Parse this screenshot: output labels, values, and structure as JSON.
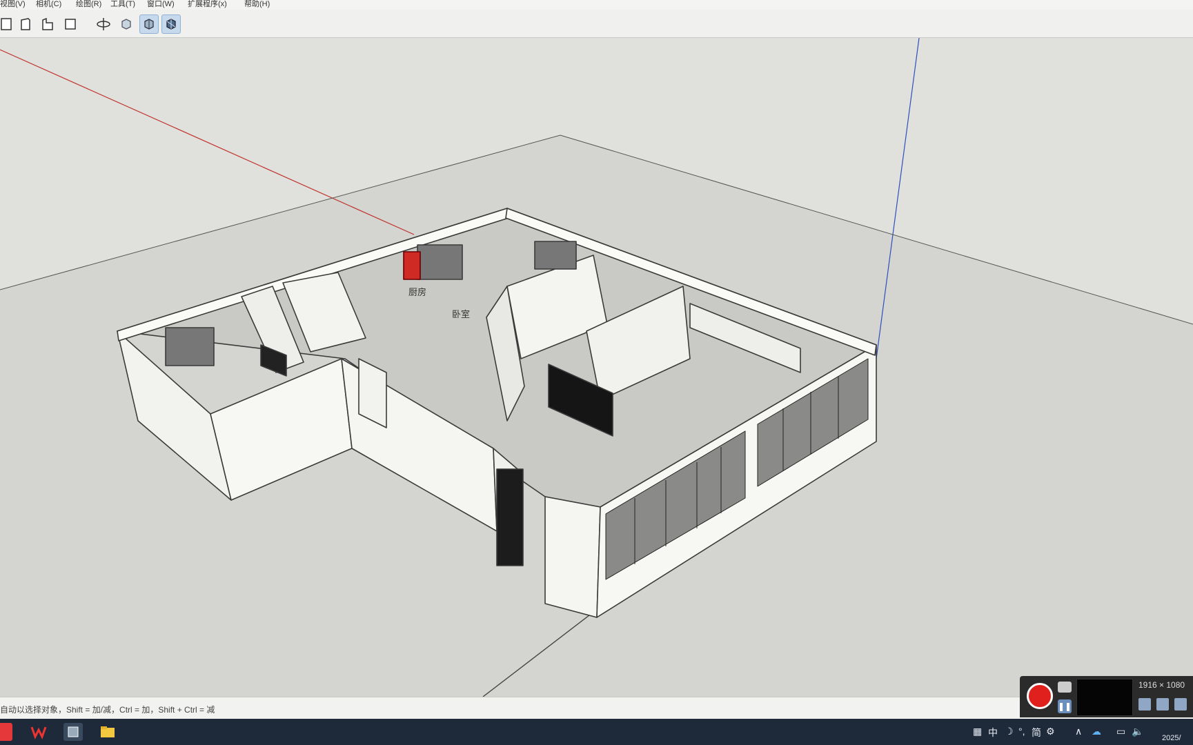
{
  "menu": {
    "items": [
      "视图(V)",
      "相机(C)",
      "绘图(R)",
      "工具(T)",
      "窗口(W)",
      "扩展程序(x)",
      "帮助(H)"
    ]
  },
  "toolbar": {
    "buttons": [
      {
        "icon": "top-view-icon"
      },
      {
        "icon": "front-view-icon"
      },
      {
        "icon": "side-view-icon"
      },
      {
        "icon": "back-view-icon"
      },
      {
        "icon": "orbit-icon"
      },
      {
        "icon": "xray-style-icon"
      },
      {
        "icon": "shaded-style-icon"
      },
      {
        "icon": "shaded-textures-icon"
      }
    ]
  },
  "model": {
    "labels": [
      "厨房",
      "卧室"
    ]
  },
  "status": {
    "hint": "自动以选择对象，Shift = 加/减，Ctrl = 加，Shift + Ctrl = 减"
  },
  "recorder": {
    "resolution": "1916 × 1080"
  },
  "taskbar": {
    "tray_text": "中",
    "ime_text": "简",
    "clock": "2025/"
  },
  "colors": {
    "wall": "#f5f5f2",
    "edge": "#3a3a3a",
    "floor": "#d2d2cf",
    "axis_red": "#c0302a",
    "axis_blue": "#2a4fc0",
    "record": "#e0201c"
  }
}
